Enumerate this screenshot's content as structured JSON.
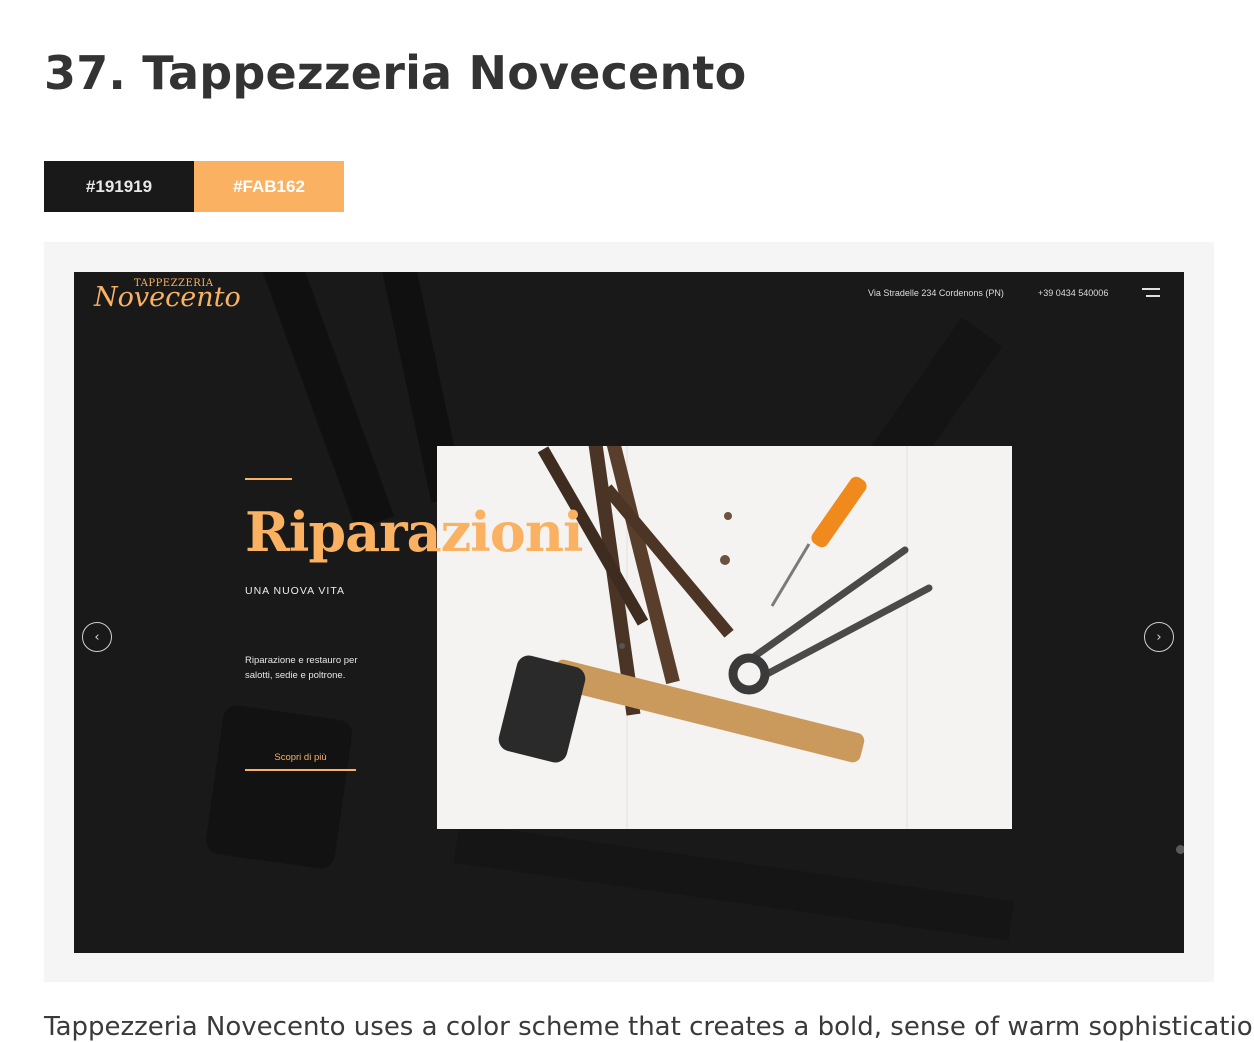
{
  "article": {
    "heading": "37. Tappezzeria Novecento",
    "paragraph_start": "Tappezzeria Novecento uses a color scheme that creates a bold, sense of warm sophistication"
  },
  "palette": [
    {
      "label": "#191919",
      "color": "#191919"
    },
    {
      "label": "#FAB162",
      "color": "#FAB162"
    }
  ],
  "site": {
    "logo": {
      "small": "TAPPEZZERIA",
      "script": "Novecento"
    },
    "nav": {
      "address": "Via Stradelle 234 Cordenons (PN)",
      "phone": "+39 0434 540006",
      "menu_icon": "hamburger-icon"
    },
    "hero": {
      "title": "Riparazioni",
      "subtitle": "UNA NUOVA VITA",
      "description": "Riparazione e restauro per salotti, sedie e poltrone.",
      "cta": "Scopri di più"
    },
    "arrows": {
      "prev": "‹",
      "next": "›"
    },
    "colors": {
      "background": "#191919",
      "accent": "#FAB162"
    }
  }
}
